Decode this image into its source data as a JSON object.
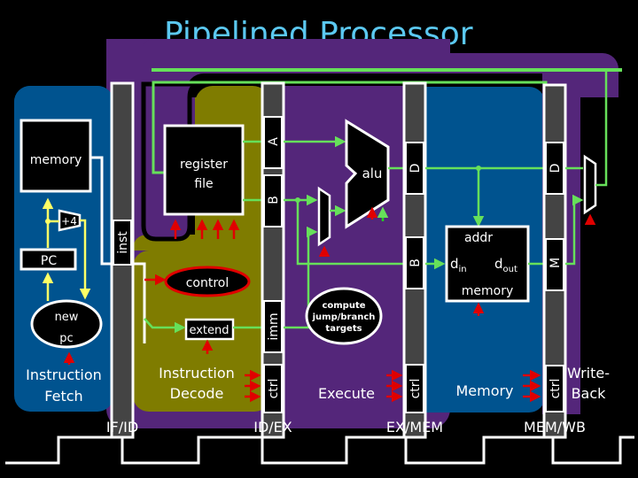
{
  "title": "Pipelined Processor",
  "colors": {
    "fetch_bg": "#00538f",
    "decode_bg": "#7f7c00",
    "execute_bg": "#54267a",
    "wire": "#66e05a",
    "control_signal": "#e00000",
    "title": "#5bc8f0",
    "register_bar": "#444444"
  },
  "stages": {
    "fetch": {
      "label_line1": "Instruction",
      "label_line2": "Fetch"
    },
    "decode": {
      "label_line1": "Instruction",
      "label_line2": "Decode"
    },
    "execute": {
      "label": "Execute"
    },
    "memory": {
      "label": "Memory"
    },
    "writeback": {
      "label_line1": "Write-",
      "label_line2": "Back"
    }
  },
  "blocks": {
    "instr_memory": "memory",
    "plus4": "+4",
    "pc": "PC",
    "new_pc_line1": "new",
    "new_pc_line2": "pc",
    "register_file_line1": "register",
    "register_file_line2": "file",
    "control": "control",
    "extend": "extend",
    "alu": "alu",
    "branch_line1": "compute",
    "branch_line2": "jump/branch",
    "branch_line3": "targets",
    "data_mem_addr": "addr",
    "data_mem_din": "d",
    "data_mem_din_sub": "in",
    "data_mem_dout": "d",
    "data_mem_dout_sub": "out",
    "data_mem_label": "memory"
  },
  "pipeline_registers": [
    {
      "name": "IF/ID",
      "fields": [
        "inst"
      ]
    },
    {
      "name": "ID/EX",
      "fields": [
        "A",
        "B",
        "imm",
        "ctrl"
      ]
    },
    {
      "name": "EX/MEM",
      "fields": [
        "D",
        "B",
        "ctrl"
      ]
    },
    {
      "name": "MEM/WB",
      "fields": [
        "D",
        "M",
        "ctrl"
      ]
    }
  ]
}
